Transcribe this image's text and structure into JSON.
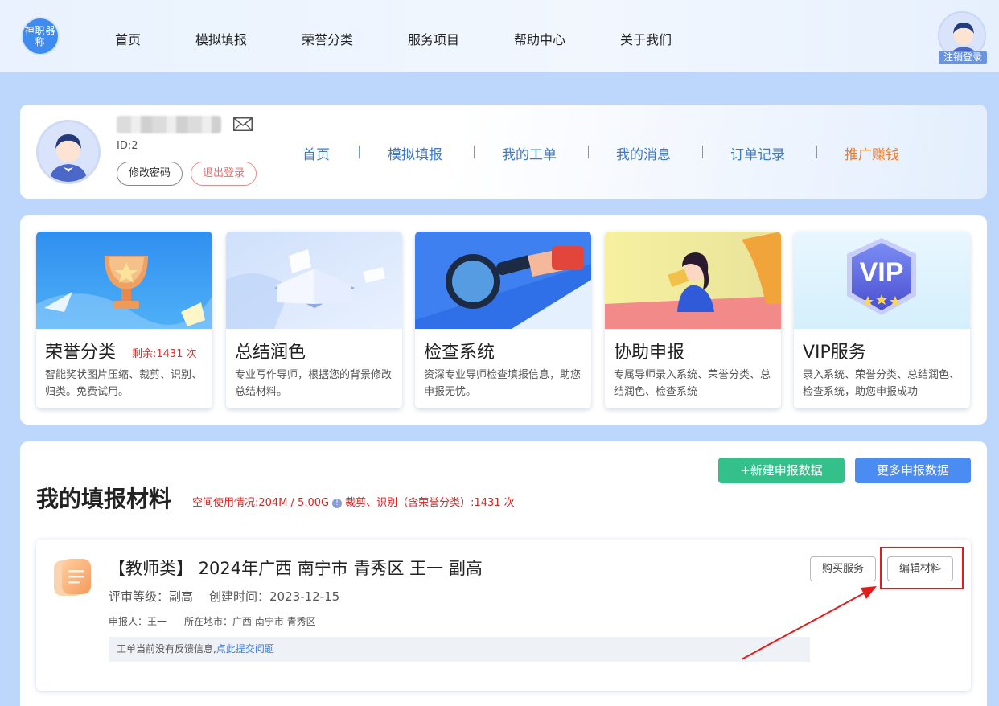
{
  "app": {
    "logo_text": "神职器称"
  },
  "top_nav": {
    "items": [
      "首页",
      "模拟填报",
      "荣誉分类",
      "服务项目",
      "帮助中心",
      "关于我们"
    ],
    "logout_label": "注销登录"
  },
  "profile": {
    "id_label": "ID:2",
    "change_password": "修改密码",
    "logout": "退出登录",
    "nav": [
      "首页",
      "模拟填报",
      "我的工单",
      "我的消息",
      "订单记录",
      "推广赚钱"
    ]
  },
  "services": [
    {
      "title": "荣誉分类",
      "extra": "剩余:1431 次",
      "desc": "智能奖状图片压缩、裁剪、识别、归类。免费试用。"
    },
    {
      "title": "总结润色",
      "extra": "",
      "desc": "专业写作导师，根据您的背景修改总结材料。"
    },
    {
      "title": "检查系统",
      "extra": "",
      "desc": "资深专业导师检查填报信息，助您申报无忧。"
    },
    {
      "title": "协助申报",
      "extra": "",
      "desc": "专属导师录入系统、荣誉分类、总结润色、检查系统"
    },
    {
      "title": "VIP服务",
      "extra": "",
      "desc": "录入系统、荣誉分类、总结润色、检查系统，助您申报成功"
    }
  ],
  "materials": {
    "title": "我的填报材料",
    "new_button": "+新建申报数据",
    "more_button": "更多申报数据",
    "usage_text": "空间使用情况:204M / 5.00G",
    "usage_extra": "裁剪、识别（含荣誉分类）:1431 次",
    "items": [
      {
        "title": "【教师类】 2024年广西 南宁市 青秀区 王一 副高",
        "level": "评审等级：副高",
        "created": "创建时间：2023-12-15",
        "applicant": "申报人：王一",
        "location": "所在地市：广西 南宁市 青秀区",
        "feedback_text": "工单当前没有反馈信息,",
        "feedback_link": "点此提交问题",
        "buy_label": "购买服务",
        "edit_label": "编辑材料"
      }
    ]
  },
  "colors": {
    "page_bg": "#bcd7fb",
    "accent_blue": "#3e79c9",
    "accent_green": "#33c08a",
    "promo_orange": "#f07a2a",
    "annotation_red": "#e31b1b"
  }
}
